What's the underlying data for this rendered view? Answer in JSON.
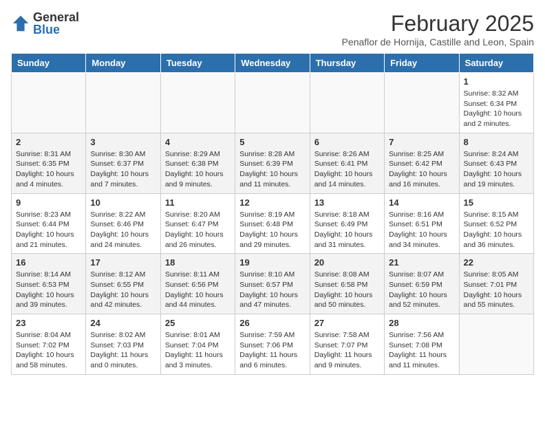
{
  "header": {
    "logo_general": "General",
    "logo_blue": "Blue",
    "main_title": "February 2025",
    "subtitle": "Penaflor de Hornija, Castille and Leon, Spain"
  },
  "weekdays": [
    "Sunday",
    "Monday",
    "Tuesday",
    "Wednesday",
    "Thursday",
    "Friday",
    "Saturday"
  ],
  "weeks": [
    [
      {
        "day": "",
        "info": ""
      },
      {
        "day": "",
        "info": ""
      },
      {
        "day": "",
        "info": ""
      },
      {
        "day": "",
        "info": ""
      },
      {
        "day": "",
        "info": ""
      },
      {
        "day": "",
        "info": ""
      },
      {
        "day": "1",
        "info": "Sunrise: 8:32 AM\nSunset: 6:34 PM\nDaylight: 10 hours and 2 minutes."
      }
    ],
    [
      {
        "day": "2",
        "info": "Sunrise: 8:31 AM\nSunset: 6:35 PM\nDaylight: 10 hours and 4 minutes."
      },
      {
        "day": "3",
        "info": "Sunrise: 8:30 AM\nSunset: 6:37 PM\nDaylight: 10 hours and 7 minutes."
      },
      {
        "day": "4",
        "info": "Sunrise: 8:29 AM\nSunset: 6:38 PM\nDaylight: 10 hours and 9 minutes."
      },
      {
        "day": "5",
        "info": "Sunrise: 8:28 AM\nSunset: 6:39 PM\nDaylight: 10 hours and 11 minutes."
      },
      {
        "day": "6",
        "info": "Sunrise: 8:26 AM\nSunset: 6:41 PM\nDaylight: 10 hours and 14 minutes."
      },
      {
        "day": "7",
        "info": "Sunrise: 8:25 AM\nSunset: 6:42 PM\nDaylight: 10 hours and 16 minutes."
      },
      {
        "day": "8",
        "info": "Sunrise: 8:24 AM\nSunset: 6:43 PM\nDaylight: 10 hours and 19 minutes."
      }
    ],
    [
      {
        "day": "9",
        "info": "Sunrise: 8:23 AM\nSunset: 6:44 PM\nDaylight: 10 hours and 21 minutes."
      },
      {
        "day": "10",
        "info": "Sunrise: 8:22 AM\nSunset: 6:46 PM\nDaylight: 10 hours and 24 minutes."
      },
      {
        "day": "11",
        "info": "Sunrise: 8:20 AM\nSunset: 6:47 PM\nDaylight: 10 hours and 26 minutes."
      },
      {
        "day": "12",
        "info": "Sunrise: 8:19 AM\nSunset: 6:48 PM\nDaylight: 10 hours and 29 minutes."
      },
      {
        "day": "13",
        "info": "Sunrise: 8:18 AM\nSunset: 6:49 PM\nDaylight: 10 hours and 31 minutes."
      },
      {
        "day": "14",
        "info": "Sunrise: 8:16 AM\nSunset: 6:51 PM\nDaylight: 10 hours and 34 minutes."
      },
      {
        "day": "15",
        "info": "Sunrise: 8:15 AM\nSunset: 6:52 PM\nDaylight: 10 hours and 36 minutes."
      }
    ],
    [
      {
        "day": "16",
        "info": "Sunrise: 8:14 AM\nSunset: 6:53 PM\nDaylight: 10 hours and 39 minutes."
      },
      {
        "day": "17",
        "info": "Sunrise: 8:12 AM\nSunset: 6:55 PM\nDaylight: 10 hours and 42 minutes."
      },
      {
        "day": "18",
        "info": "Sunrise: 8:11 AM\nSunset: 6:56 PM\nDaylight: 10 hours and 44 minutes."
      },
      {
        "day": "19",
        "info": "Sunrise: 8:10 AM\nSunset: 6:57 PM\nDaylight: 10 hours and 47 minutes."
      },
      {
        "day": "20",
        "info": "Sunrise: 8:08 AM\nSunset: 6:58 PM\nDaylight: 10 hours and 50 minutes."
      },
      {
        "day": "21",
        "info": "Sunrise: 8:07 AM\nSunset: 6:59 PM\nDaylight: 10 hours and 52 minutes."
      },
      {
        "day": "22",
        "info": "Sunrise: 8:05 AM\nSunset: 7:01 PM\nDaylight: 10 hours and 55 minutes."
      }
    ],
    [
      {
        "day": "23",
        "info": "Sunrise: 8:04 AM\nSunset: 7:02 PM\nDaylight: 10 hours and 58 minutes."
      },
      {
        "day": "24",
        "info": "Sunrise: 8:02 AM\nSunset: 7:03 PM\nDaylight: 11 hours and 0 minutes."
      },
      {
        "day": "25",
        "info": "Sunrise: 8:01 AM\nSunset: 7:04 PM\nDaylight: 11 hours and 3 minutes."
      },
      {
        "day": "26",
        "info": "Sunrise: 7:59 AM\nSunset: 7:06 PM\nDaylight: 11 hours and 6 minutes."
      },
      {
        "day": "27",
        "info": "Sunrise: 7:58 AM\nSunset: 7:07 PM\nDaylight: 11 hours and 9 minutes."
      },
      {
        "day": "28",
        "info": "Sunrise: 7:56 AM\nSunset: 7:08 PM\nDaylight: 11 hours and 11 minutes."
      },
      {
        "day": "",
        "info": ""
      }
    ]
  ]
}
